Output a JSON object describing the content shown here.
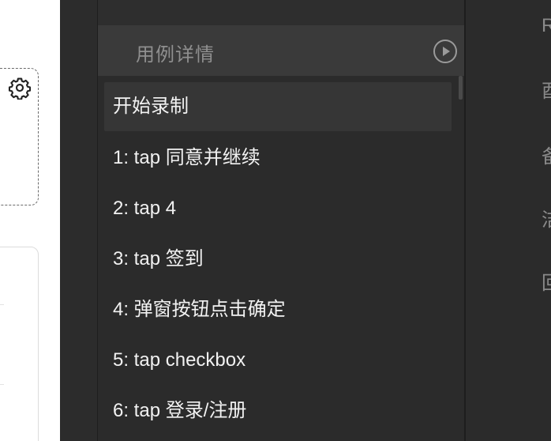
{
  "panel": {
    "title": "用例详情"
  },
  "steps": [
    "开始录制",
    "1: tap 同意并继续",
    "2: tap 4",
    "3: tap 签到",
    "4: 弹窗按钮点击确定",
    "5: tap checkbox",
    "6: tap 登录/注册"
  ],
  "right_menu": [
    "R",
    "酉",
    "备",
    "洁",
    "回"
  ],
  "icons": {
    "settings": "gear-icon",
    "play": "play-circle-icon"
  }
}
